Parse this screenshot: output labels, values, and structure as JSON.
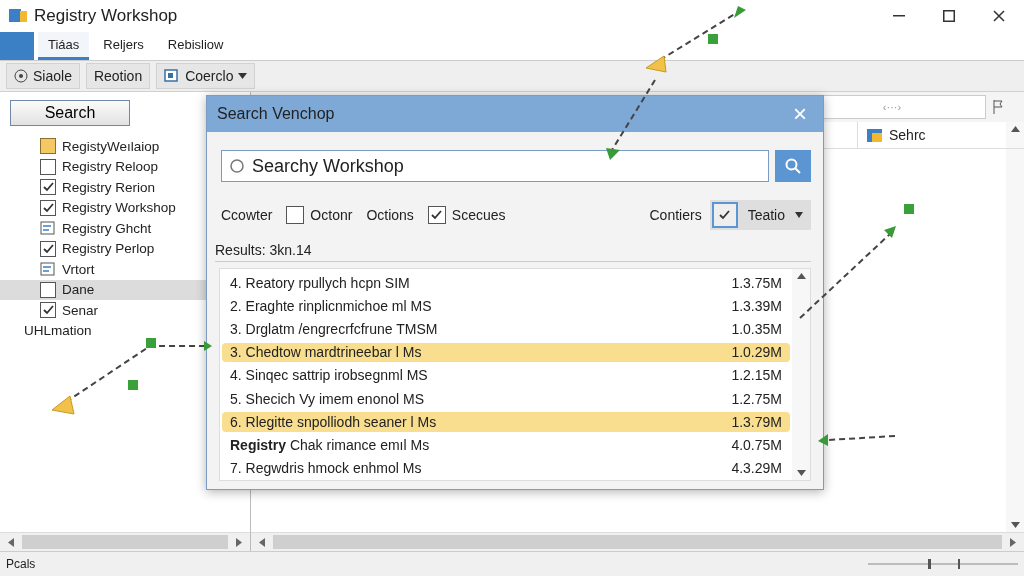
{
  "window": {
    "title": "Registry Workshop"
  },
  "menu": [
    {
      "label": "Tiáas",
      "selected": true
    },
    {
      "label": "Reljers",
      "selected": false
    },
    {
      "label": "Rebisliow",
      "selected": false
    }
  ],
  "toolbar": [
    {
      "label": "Siaole",
      "kind": "icon"
    },
    {
      "label": "Reotion",
      "kind": "plain"
    },
    {
      "label": "Coerclo",
      "kind": "dropdown"
    }
  ],
  "sidebar": {
    "search_button": "Search",
    "items": [
      {
        "label": "RegistyWeılaiop",
        "kind": "swatch",
        "selected": false
      },
      {
        "label": "Registry Reloop",
        "kind": "checkbox",
        "checked": false,
        "selected": false
      },
      {
        "label": "Registry Rerion",
        "kind": "checkbox",
        "checked": true,
        "selected": false
      },
      {
        "label": "Registry Workshop",
        "kind": "checkbox",
        "checked": true,
        "selected": false
      },
      {
        "label": "Registry Ghcht",
        "kind": "icon",
        "selected": false
      },
      {
        "label": "Registry Perlop",
        "kind": "checkbox",
        "checked": true,
        "selected": false
      },
      {
        "label": "Vrtort",
        "kind": "icon",
        "selected": false
      },
      {
        "label": "Dane",
        "kind": "checkbox",
        "checked": false,
        "selected": true
      },
      {
        "label": "Senar",
        "kind": "checkbox",
        "checked": true,
        "selected": false
      },
      {
        "label": "UHLmation",
        "kind": "label",
        "selected": false
      }
    ]
  },
  "address": {
    "value": "‹···›"
  },
  "column_header": {
    "label": "Sehrc"
  },
  "dialog": {
    "title": "Search Venchop",
    "close": "×",
    "search": {
      "value": "Searchy Workshop"
    },
    "options": [
      {
        "kind": "label",
        "label": "Ccowter"
      },
      {
        "kind": "checkbox",
        "label": "Octonr",
        "checked": false
      },
      {
        "kind": "label",
        "label": "Octions"
      },
      {
        "kind": "checkbox",
        "label": "Scecues",
        "checked": true
      },
      {
        "kind": "label",
        "label": "Contiers"
      },
      {
        "kind": "dropdown",
        "label": "Teatio",
        "checked": true
      }
    ],
    "results_label": "Results: 3kn.14",
    "results": [
      {
        "name": "4. Reatory rpullych hcpn SIM",
        "size": "1.3.75M",
        "highlighted": false
      },
      {
        "name": "2. Eraghte rinplicnmichoe ml MS",
        "size": "1.3.39M",
        "highlighted": false
      },
      {
        "name": "3. Drglatm /engrecrfcfrune TMSM",
        "size": "1.0.35M",
        "highlighted": false
      },
      {
        "name": "3. Chedtow mardtrineebar l Ms",
        "size": "1.0.29M",
        "highlighted": true
      },
      {
        "name": "4. Sinqec sattrip irobsegnml MS",
        "size": "1.2.15M",
        "highlighted": false
      },
      {
        "name": "5. Shecich Vy imem enonol MS",
        "size": "1.2.75M",
        "highlighted": false
      },
      {
        "name": "6. Rlegitte snpolliodh seaner l Ms",
        "size": "1.3.79M",
        "highlighted": true
      },
      {
        "name": "**Registry** Chak rimance emıl Ms",
        "size": "4.0.75M",
        "highlighted": false
      },
      {
        "name": "7. Regwdris hmock enhmol Ms",
        "size": "4.3.29M",
        "highlighted": false
      }
    ]
  },
  "status_bar": {
    "text": "Pcals"
  }
}
